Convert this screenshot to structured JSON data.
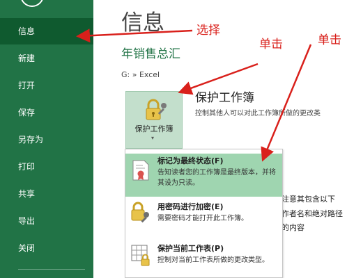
{
  "nav": {
    "items": [
      {
        "label": "信息",
        "selected": true
      },
      {
        "label": "新建"
      },
      {
        "label": "打开"
      },
      {
        "label": "保存"
      },
      {
        "label": "另存为"
      },
      {
        "label": "打印"
      },
      {
        "label": "共享"
      },
      {
        "label": "导出"
      },
      {
        "label": "关闭"
      }
    ]
  },
  "main": {
    "page_title": "信息",
    "file_name": "年销售总汇",
    "path": "G: » Excel"
  },
  "protect": {
    "button_label": "保护工作簿",
    "caret": "▾",
    "title": "保护工作簿",
    "desc": "控制其他人可以对此工作簿所做的更改类"
  },
  "partial_text": {
    "line1": "注意其包含以下",
    "line2": "作者名和绝对路径",
    "line3": "的内容"
  },
  "menu": {
    "items": [
      {
        "title": "标记为最终状态(F)",
        "desc": "告知读者您的工作簿是最终版本，并将其设为只读。",
        "highlighted": true
      },
      {
        "title": "用密码进行加密(E)",
        "desc": "需要密码才能打开此工作簿。"
      },
      {
        "title": "保护当前工作表(P)",
        "desc": "控制对当前工作表所做的更改类型。"
      }
    ]
  },
  "annotations": {
    "select": "选择",
    "click1": "单击",
    "click2": "单击"
  },
  "colors": {
    "nav_bg": "#217346",
    "nav_selected": "#0f5a2f",
    "accent": "#217346",
    "menu_highlight": "#9fd5b0",
    "annotation": "#d9201b"
  }
}
